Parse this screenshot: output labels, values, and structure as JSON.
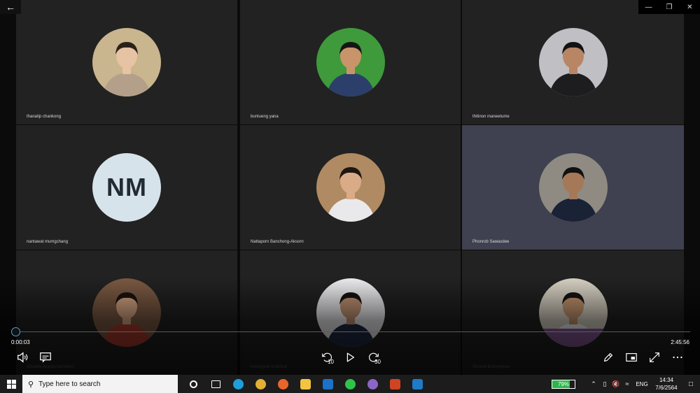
{
  "window": {
    "back_icon": "arrow-left-icon",
    "min": "—",
    "max": "❐",
    "close": "✕"
  },
  "participants": [
    {
      "name": "thanatip chankong",
      "avatar": "photo",
      "bg": "#c9b58e",
      "shirt": "#b4a08a",
      "skin": "#e6c3a2",
      "hair": "#2b211b"
    },
    {
      "name": "buntueng yana",
      "avatar": "photo",
      "bg": "#3f9a3b",
      "shirt": "#2c3f6a",
      "skin": "#c8946a",
      "hair": "#161616"
    },
    {
      "name": "thitinon maneetume",
      "avatar": "photo",
      "bg": "#bfbfc4",
      "shirt": "#1d1d20",
      "skin": "#b88565",
      "hair": "#121212"
    },
    {
      "name": "nantawat mumgchang",
      "avatar": "initials",
      "initials": "NM"
    },
    {
      "name": "Nattaporn Banchong-Aksorn",
      "avatar": "photo",
      "bg": "#b08a62",
      "shirt": "#e9e9ec",
      "skin": "#d9ab87",
      "hair": "#1d1612"
    },
    {
      "name": "Phonrob Sawasdee",
      "avatar": "photo",
      "bg": "#8f8b82",
      "shirt": "#1a2236",
      "skin": "#a57858",
      "hair": "#111111",
      "active": true
    },
    {
      "name": "kitiwalla duangchanwiken",
      "avatar": "photo",
      "bg": "#7c5a43",
      "shirt": "#b13b2e",
      "skin": "#d7a683",
      "hair": "#1c1410"
    },
    {
      "name": "kreengsak kraklitrat",
      "avatar": "photo",
      "bg": "#f0f0f2",
      "shirt": "#1f2b46",
      "skin": "#c49474",
      "hair": "#141414"
    },
    {
      "name": "Sorawit Boonyethee",
      "avatar": "photo",
      "bg": "#d9d3c5",
      "shirt": "#f4f4f4",
      "skin": "#c7976f",
      "hair": "#151515",
      "table": "#8a5a9a"
    }
  ],
  "player": {
    "current_time": "0:00:03",
    "total_time": "2:45:56",
    "progress": 0.0003,
    "volume_icon": "volume-icon",
    "captions_icon": "captions-icon",
    "skip_back_label": "10",
    "skip_forward_label": "30",
    "play_icon": "play-icon",
    "edit_icon": "pencil-icon",
    "miniview_icon": "mini-view-icon",
    "fullscreen_icon": "fullscreen-icon",
    "more_icon": "more-icon"
  },
  "taskbar": {
    "search_placeholder": "Type here to search",
    "apps": [
      {
        "name": "cortana-icon",
        "color": "#ffffff"
      },
      {
        "name": "task-view-icon",
        "color": "#ffffff"
      },
      {
        "name": "edge-icon",
        "color": "#1e9fd9"
      },
      {
        "name": "chrome-icon",
        "color": "#e2b034"
      },
      {
        "name": "firefox-icon",
        "color": "#e8662b"
      },
      {
        "name": "file-explorer-icon",
        "color": "#f2c440"
      },
      {
        "name": "outlook-icon",
        "color": "#1b72c9"
      },
      {
        "name": "line-icon",
        "color": "#2ec44a"
      },
      {
        "name": "app-icon-purple",
        "color": "#8b66c7"
      },
      {
        "name": "powerpoint-icon",
        "color": "#d04423"
      },
      {
        "name": "movies-tv-icon",
        "color": "#1f7ac8"
      }
    ],
    "battery_percent": "79%",
    "battery_level": 0.79,
    "lang": "ENG",
    "time": "14:34",
    "date": "7/6/2564"
  }
}
